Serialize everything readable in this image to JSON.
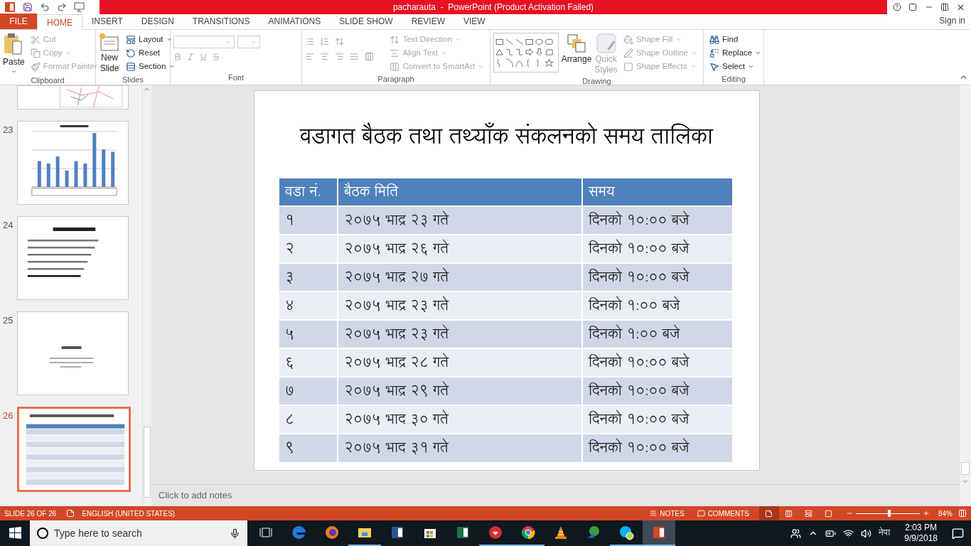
{
  "window": {
    "title": "pacharauta  -  PowerPoint (Product Activation Failed)",
    "sign_in": "Sign in"
  },
  "tabs": [
    {
      "label": "FILE",
      "kind": "file",
      "selected": false
    },
    {
      "label": "HOME",
      "kind": "tab",
      "selected": true
    },
    {
      "label": "INSERT",
      "kind": "tab",
      "selected": false
    },
    {
      "label": "DESIGN",
      "kind": "tab",
      "selected": false
    },
    {
      "label": "TRANSITIONS",
      "kind": "tab",
      "selected": false
    },
    {
      "label": "ANIMATIONS",
      "kind": "tab",
      "selected": false
    },
    {
      "label": "SLIDE SHOW",
      "kind": "tab",
      "selected": false
    },
    {
      "label": "REVIEW",
      "kind": "tab",
      "selected": false
    },
    {
      "label": "VIEW",
      "kind": "tab",
      "selected": false
    }
  ],
  "ribbon": {
    "clipboard": {
      "label": "Clipboard",
      "paste": {
        "label": "Paste",
        "disabled": false
      },
      "small": [
        {
          "label": "Cut",
          "kind": "scissors",
          "disabled": true,
          "dropdown": false
        },
        {
          "label": "Copy",
          "kind": "copy",
          "disabled": true,
          "dropdown": true
        },
        {
          "label": "Format Painter",
          "kind": "brush",
          "disabled": true,
          "dropdown": false
        }
      ]
    },
    "slides": {
      "label": "Slides",
      "new_slide": {
        "label": "New Slide",
        "disabled": false
      },
      "small": [
        {
          "label": "Layout",
          "kind": "layout",
          "disabled": false,
          "dropdown": true
        },
        {
          "label": "Reset",
          "kind": "reset",
          "disabled": false,
          "dropdown": false
        },
        {
          "label": "Section",
          "kind": "section",
          "disabled": false,
          "dropdown": true
        }
      ]
    },
    "font": {
      "label": "Font"
    },
    "paragraph": {
      "label": "Paragraph",
      "small": [
        {
          "label": "Text Direction",
          "kind": "textdir",
          "disabled": true,
          "dropdown": true
        },
        {
          "label": "Align Text",
          "kind": "align",
          "disabled": true,
          "dropdown": true
        },
        {
          "label": "Convert to SmartArt",
          "kind": "smartart",
          "disabled": true,
          "dropdown": true
        }
      ]
    },
    "drawing": {
      "label": "Drawing",
      "large": [
        {
          "label": "Arrange",
          "kind": "arrange",
          "disabled": false
        },
        {
          "label": "Quick Styles",
          "kind": "styles",
          "disabled": true
        }
      ],
      "small": [
        {
          "label": "Shape Fill",
          "kind": "fill",
          "disabled": true,
          "dropdown": true
        },
        {
          "label": "Shape Outline",
          "kind": "outline",
          "disabled": true,
          "dropdown": true
        },
        {
          "label": "Shape Effects",
          "kind": "effects",
          "disabled": true,
          "dropdown": true
        }
      ]
    },
    "editing": {
      "label": "Editing",
      "small": [
        {
          "label": "Find",
          "kind": "find",
          "disabled": false,
          "dropdown": false
        },
        {
          "label": "Replace",
          "kind": "replace",
          "disabled": false,
          "dropdown": true
        },
        {
          "label": "Select",
          "kind": "select",
          "disabled": false,
          "dropdown": true
        }
      ]
    }
  },
  "thumbnails": [
    {
      "kind": "map",
      "selected": false
    },
    {
      "number": "23",
      "kind": "chart",
      "selected": false
    },
    {
      "number": "24",
      "kind": "bullets",
      "selected": false
    },
    {
      "number": "25",
      "kind": "text",
      "selected": false
    },
    {
      "number": "26",
      "kind": "table",
      "selected": true
    }
  ],
  "slide": {
    "title": "वडागत बैठक तथा तथ्याँक संकलनको समय तालिका",
    "columns": [
      "वडा नं.",
      "बैठक मिति",
      "समय"
    ],
    "rows": [
      [
        "१",
        "२०७५ भाद्र २३ गते",
        "दिनको १०:०० बजे"
      ],
      [
        "२",
        "२०७५ भाद्र २६ गते",
        "दिनको १०:०० बजे"
      ],
      [
        "३",
        "२०७५ भाद्र २७ गते",
        "दिनको १०:०० बजे"
      ],
      [
        "४",
        "२०७५ भाद्र २३ गते",
        "दिनको १:०० बजे"
      ],
      [
        "५",
        "२०७५ भाद्र २३ गते",
        "दिनको १:०० बजे"
      ],
      [
        "६",
        "२०७५ भाद्र २८ गते",
        "दिनको १०:०० बजे"
      ],
      [
        "७",
        "२०७५ भाद्र २९ गते",
        "दिनको १०:०० बजे"
      ],
      [
        "८",
        "२०७५ भाद ३० गते",
        "दिनको १०:०० बजे"
      ],
      [
        "९",
        "२०७५ भाद ३१ गते",
        "दिनको १०:०० बजे"
      ]
    ]
  },
  "notes": {
    "placeholder": "Click to add notes"
  },
  "status_bar": {
    "slide_info": "SLIDE 26 OF 26",
    "language": "ENGLISH (UNITED STATES)",
    "notes": "NOTES",
    "comments": "COMMENTS",
    "views": [
      {
        "kind": "normal",
        "selected": true
      },
      {
        "kind": "sorter",
        "selected": false
      },
      {
        "kind": "reading",
        "selected": false
      },
      {
        "kind": "show",
        "selected": false
      }
    ],
    "zoom": {
      "level": 0.52,
      "reading": "84%"
    }
  },
  "taskbar": {
    "search": {
      "placeholder": "Type here to search"
    },
    "apps": [
      {
        "kind": "taskview",
        "running": false,
        "selected": false
      },
      {
        "kind": "edge",
        "running": false,
        "selected": false
      },
      {
        "kind": "firefox",
        "running": false,
        "selected": false
      },
      {
        "kind": "folder",
        "running": true,
        "selected": false
      },
      {
        "kind": "word",
        "running": false,
        "selected": false
      },
      {
        "kind": "store",
        "running": false,
        "selected": false
      },
      {
        "kind": "excel",
        "running": false,
        "selected": false
      },
      {
        "kind": "downloader",
        "running": true,
        "selected": false
      },
      {
        "kind": "chrome",
        "running": true,
        "selected": false
      },
      {
        "kind": "vlc",
        "running": false,
        "selected": false
      },
      {
        "kind": "globe",
        "running": false,
        "selected": false
      },
      {
        "kind": "skype",
        "running": true,
        "selected": false
      },
      {
        "kind": "powerpoint",
        "running": true,
        "selected": true
      }
    ],
    "language": "नेपा",
    "time": "2:03 PM",
    "date": "9/9/2018"
  }
}
